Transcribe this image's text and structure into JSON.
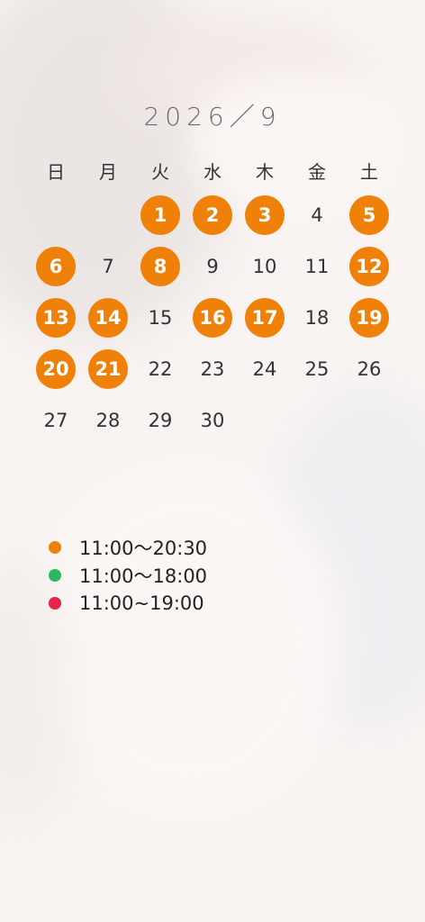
{
  "title": "2026／9",
  "weekdays": [
    "日",
    "月",
    "火",
    "水",
    "木",
    "金",
    "土"
  ],
  "accent_color": "#ef8008",
  "days": [
    {
      "n": "",
      "on": false
    },
    {
      "n": "",
      "on": false
    },
    {
      "n": "1",
      "on": true
    },
    {
      "n": "2",
      "on": true
    },
    {
      "n": "3",
      "on": true
    },
    {
      "n": "4",
      "on": false
    },
    {
      "n": "5",
      "on": true
    },
    {
      "n": "6",
      "on": true
    },
    {
      "n": "7",
      "on": false
    },
    {
      "n": "8",
      "on": true
    },
    {
      "n": "9",
      "on": false
    },
    {
      "n": "10",
      "on": false
    },
    {
      "n": "11",
      "on": false
    },
    {
      "n": "12",
      "on": true
    },
    {
      "n": "13",
      "on": true
    },
    {
      "n": "14",
      "on": true
    },
    {
      "n": "15",
      "on": false
    },
    {
      "n": "16",
      "on": true
    },
    {
      "n": "17",
      "on": true
    },
    {
      "n": "18",
      "on": false
    },
    {
      "n": "19",
      "on": true
    },
    {
      "n": "20",
      "on": true
    },
    {
      "n": "21",
      "on": true
    },
    {
      "n": "22",
      "on": false
    },
    {
      "n": "23",
      "on": false
    },
    {
      "n": "24",
      "on": false
    },
    {
      "n": "25",
      "on": false
    },
    {
      "n": "26",
      "on": false
    },
    {
      "n": "27",
      "on": false
    },
    {
      "n": "28",
      "on": false
    },
    {
      "n": "29",
      "on": false
    },
    {
      "n": "30",
      "on": false
    }
  ],
  "legend": [
    {
      "label": "11:00～20:30",
      "color": "#ef8008"
    },
    {
      "label": "11:00～18:00",
      "color": "#2bb860"
    },
    {
      "label": "11:00~19:00",
      "color": "#e8234a"
    }
  ]
}
